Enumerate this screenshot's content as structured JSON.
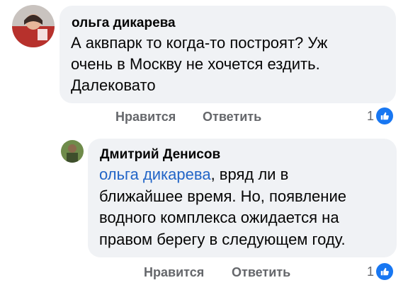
{
  "comments": [
    {
      "author": "ольга дикарева",
      "lines": [
        "А аквпарк то когда-то построят? Уж",
        "очень в Москву не хочется ездить.",
        "Далековато"
      ],
      "actions": {
        "like": "Нравится",
        "reply": "Ответить"
      },
      "reactions": {
        "count": "1",
        "icon": "like-thumb-icon"
      }
    },
    {
      "author": "Дмитрий Денисов",
      "mention": "ольга дикарева",
      "lines": [
        ", вряд ли в",
        "ближайшее время. Но, появление",
        "водного комплекса ожидается на",
        "правом берегу в следующем году."
      ],
      "actions": {
        "like": "Нравится",
        "reply": "Ответить"
      },
      "reactions": {
        "count": "1",
        "icon": "like-thumb-icon"
      }
    }
  ]
}
